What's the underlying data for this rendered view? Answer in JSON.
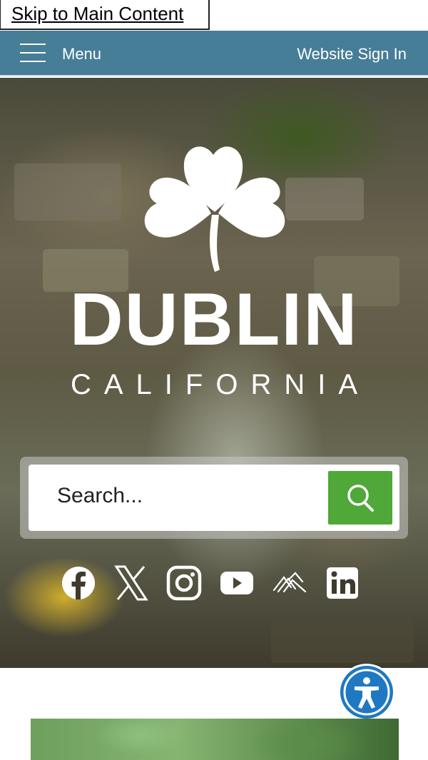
{
  "skip_link": "Skip to Main Content",
  "topbar": {
    "menu_label": "Menu",
    "sign_in_label": "Website Sign In",
    "background_color": "#467d97"
  },
  "logo": {
    "name": "DUBLIN",
    "subtitle": "CALIFORNIA",
    "icon": "shamrock-icon"
  },
  "search": {
    "placeholder": "Search...",
    "button_color": "#4fa838",
    "icon": "search-icon"
  },
  "social": [
    {
      "name": "facebook",
      "icon": "facebook-icon"
    },
    {
      "name": "x",
      "icon": "x-icon"
    },
    {
      "name": "instagram",
      "icon": "instagram-icon"
    },
    {
      "name": "youtube",
      "icon": "youtube-icon"
    },
    {
      "name": "nextdoor",
      "icon": "nextdoor-icon"
    },
    {
      "name": "linkedin",
      "icon": "linkedin-icon"
    }
  ],
  "accessibility": {
    "icon": "accessibility-icon",
    "color": "#1f78c2"
  }
}
